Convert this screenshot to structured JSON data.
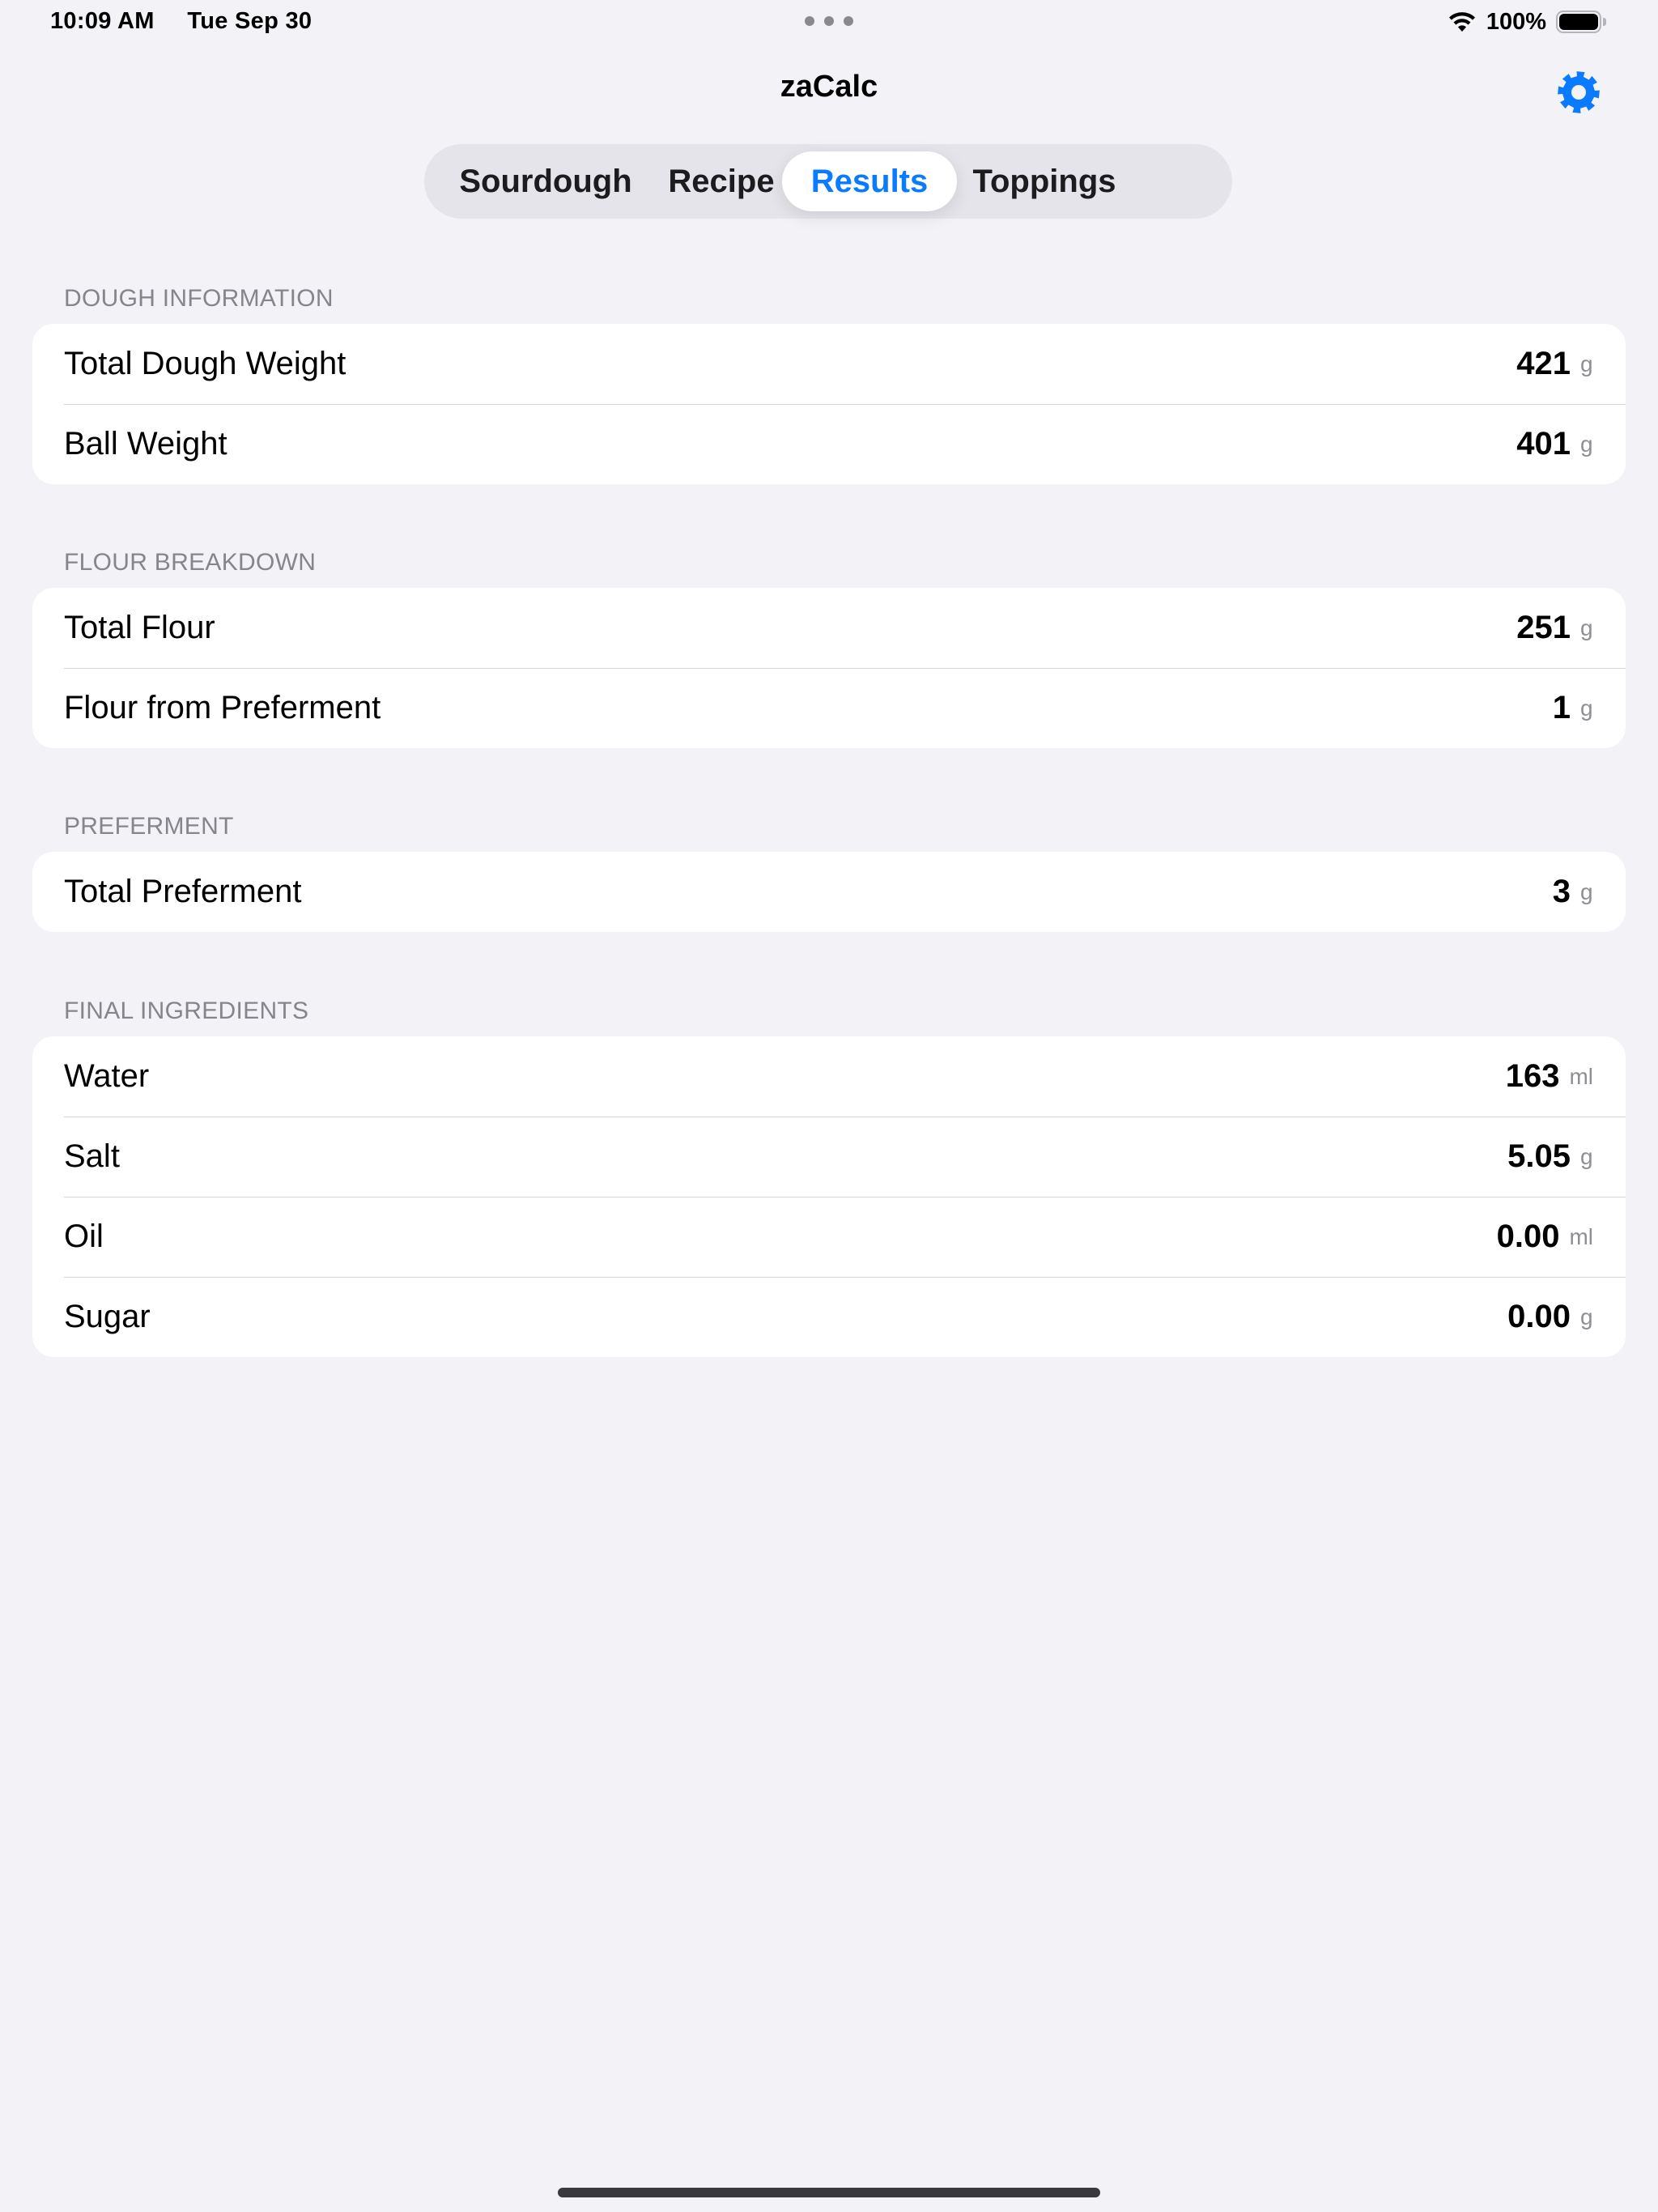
{
  "status_bar": {
    "time": "10:09 AM",
    "date": "Tue Sep 30",
    "battery": "100%",
    "battery_level": 1.0,
    "wifi_icon": "wifi-icon"
  },
  "nav": {
    "title": "zaCalc",
    "settings_icon": "gear-icon",
    "accent": "#0a7aff"
  },
  "tabs": [
    {
      "label": "Sourdough",
      "selected": false
    },
    {
      "label": "Recipe",
      "selected": false
    },
    {
      "label": "Results",
      "selected": true
    },
    {
      "label": "Toppings",
      "selected": false
    }
  ],
  "sections": [
    {
      "header": "DOUGH INFORMATION",
      "rows": [
        {
          "label": "Total Dough Weight",
          "value": "421",
          "unit": "g"
        },
        {
          "label": "Ball Weight",
          "value": "401",
          "unit": "g"
        }
      ]
    },
    {
      "header": "FLOUR BREAKDOWN",
      "rows": [
        {
          "label": "Total Flour",
          "value": "251",
          "unit": "g"
        },
        {
          "label": "Flour from Preferment",
          "value": "1",
          "unit": "g"
        }
      ]
    },
    {
      "header": "PREFERMENT",
      "rows": [
        {
          "label": "Total Preferment",
          "value": "3",
          "unit": "g"
        }
      ]
    },
    {
      "header": "FINAL INGREDIENTS",
      "rows": [
        {
          "label": "Water",
          "value": "163",
          "unit": "ml"
        },
        {
          "label": "Salt",
          "value": "5.05",
          "unit": "g"
        },
        {
          "label": "Oil",
          "value": "0.00",
          "unit": "ml"
        },
        {
          "label": "Sugar",
          "value": "0.00",
          "unit": "g"
        }
      ]
    }
  ]
}
